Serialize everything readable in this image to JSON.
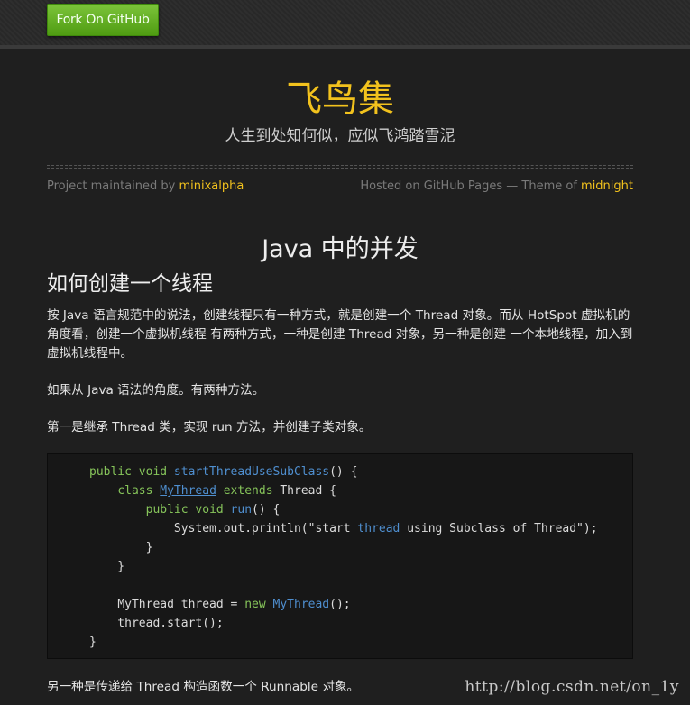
{
  "header": {
    "fork_button_label": "Fork On GitHub"
  },
  "site": {
    "title": "飞鸟集",
    "subtitle": "人生到处知何似，应似飞鸿踏雪泥"
  },
  "meta": {
    "maintained_prefix": "Project maintained by ",
    "maintainer": "minixalpha",
    "hosted_text": "Hosted on GitHub Pages — Theme of ",
    "theme_name": "midnight"
  },
  "article": {
    "title": "Java 中的并发",
    "section_title": "如何创建一个线程",
    "paragraphs": [
      "按 Java 语言规范中的说法，创建线程只有一种方式，就是创建一个 Thread 对象。而从 HotSpot 虚拟机的角度看，创建一个虚拟机线程 有两种方式，一种是创建 Thread 对象，另一种是创建 一个本地线程，加入到虚拟机线程中。",
      "如果从 Java 语法的角度。有两种方法。",
      "第一是继承 Thread 类，实现 run 方法，并创建子类对象。",
      "另一种是传递给 Thread 构造函数一个 Runnable 对象。"
    ],
    "code": {
      "line1": {
        "kw": "public void ",
        "fn": "startThreadUseSubClass",
        "rest": "() {"
      },
      "line2": {
        "indent": "    ",
        "kw1": "class ",
        "cls": "MyThread",
        "kw2": " extends",
        "rest": " Thread {"
      },
      "line3": {
        "indent": "        ",
        "kw": "public void ",
        "fn": "run",
        "rest": "() {"
      },
      "line4": {
        "indent": "            ",
        "text": "System.out.println(\"start ",
        "kw": "thread",
        "text2": " using Subclass of Thread\");"
      },
      "line5": "        }",
      "line6": "    }",
      "line7": "",
      "line8": {
        "indent": "    ",
        "text": "MyThread thread = ",
        "kw": "new",
        "sp": " ",
        "fn": "MyThread",
        "rest": "();"
      },
      "line9": "    thread.start();",
      "line10": "}"
    }
  },
  "watermark": "http://blog.csdn.net/on_1y",
  "colors": {
    "accent": "#f2c21d",
    "background": "#1f1f1f",
    "button_green": "#5fae1f",
    "code_keyword": "#86c45a",
    "code_function": "#4f8fd0"
  }
}
